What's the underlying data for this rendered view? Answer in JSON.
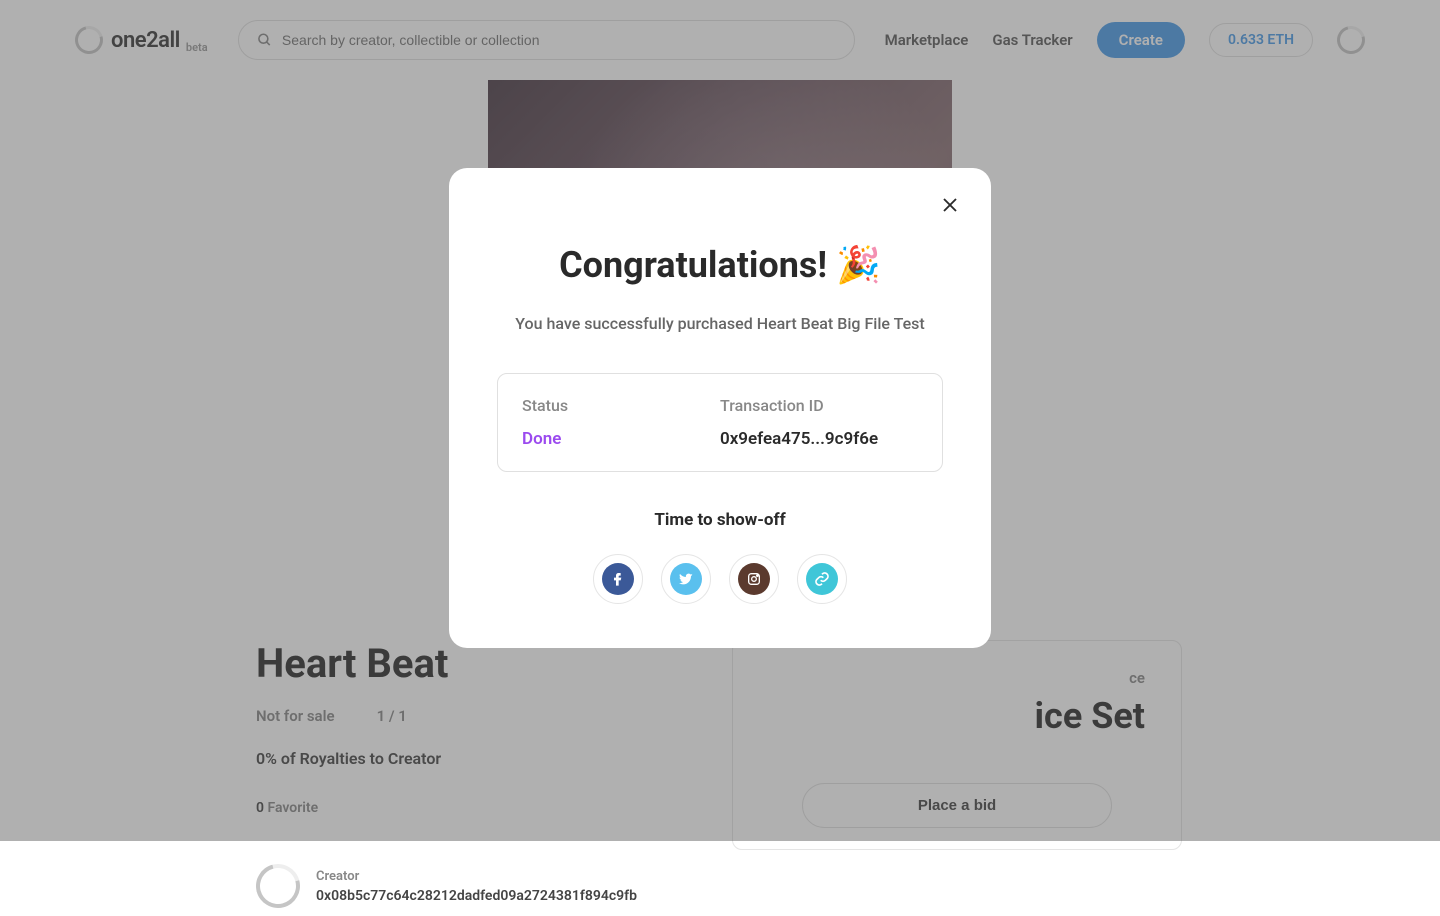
{
  "header": {
    "logo_text": "one2all",
    "logo_beta": "beta",
    "search_placeholder": "Search by creator, collectible or collection",
    "nav": {
      "marketplace": "Marketplace",
      "gas_tracker": "Gas Tracker",
      "create": "Create",
      "eth_balance": "0.633 ETH"
    }
  },
  "nft": {
    "title": "Heart Beat",
    "not_for_sale": "Not for sale",
    "count": "1 / 1",
    "royalties": "0% of Royalties to Creator",
    "favorite_count": "0",
    "favorite_label": "Favorite",
    "creator_label": "Creator",
    "creator_address": "0x08b5c77c64c28212dadfed09a2724381f894c9fb"
  },
  "side_card": {
    "label_suffix": "ce",
    "value_suffix": "ice Set",
    "place_bid": "Place a bid"
  },
  "modal": {
    "title": "Congratulations! 🎉",
    "subtitle": "You have successfully purchased Heart Beat Big File Test",
    "status_label": "Status",
    "status_value": "Done",
    "tx_label": "Transaction ID",
    "tx_value": "0x9efea475...9c9f6e",
    "showoff": "Time to show-off"
  }
}
